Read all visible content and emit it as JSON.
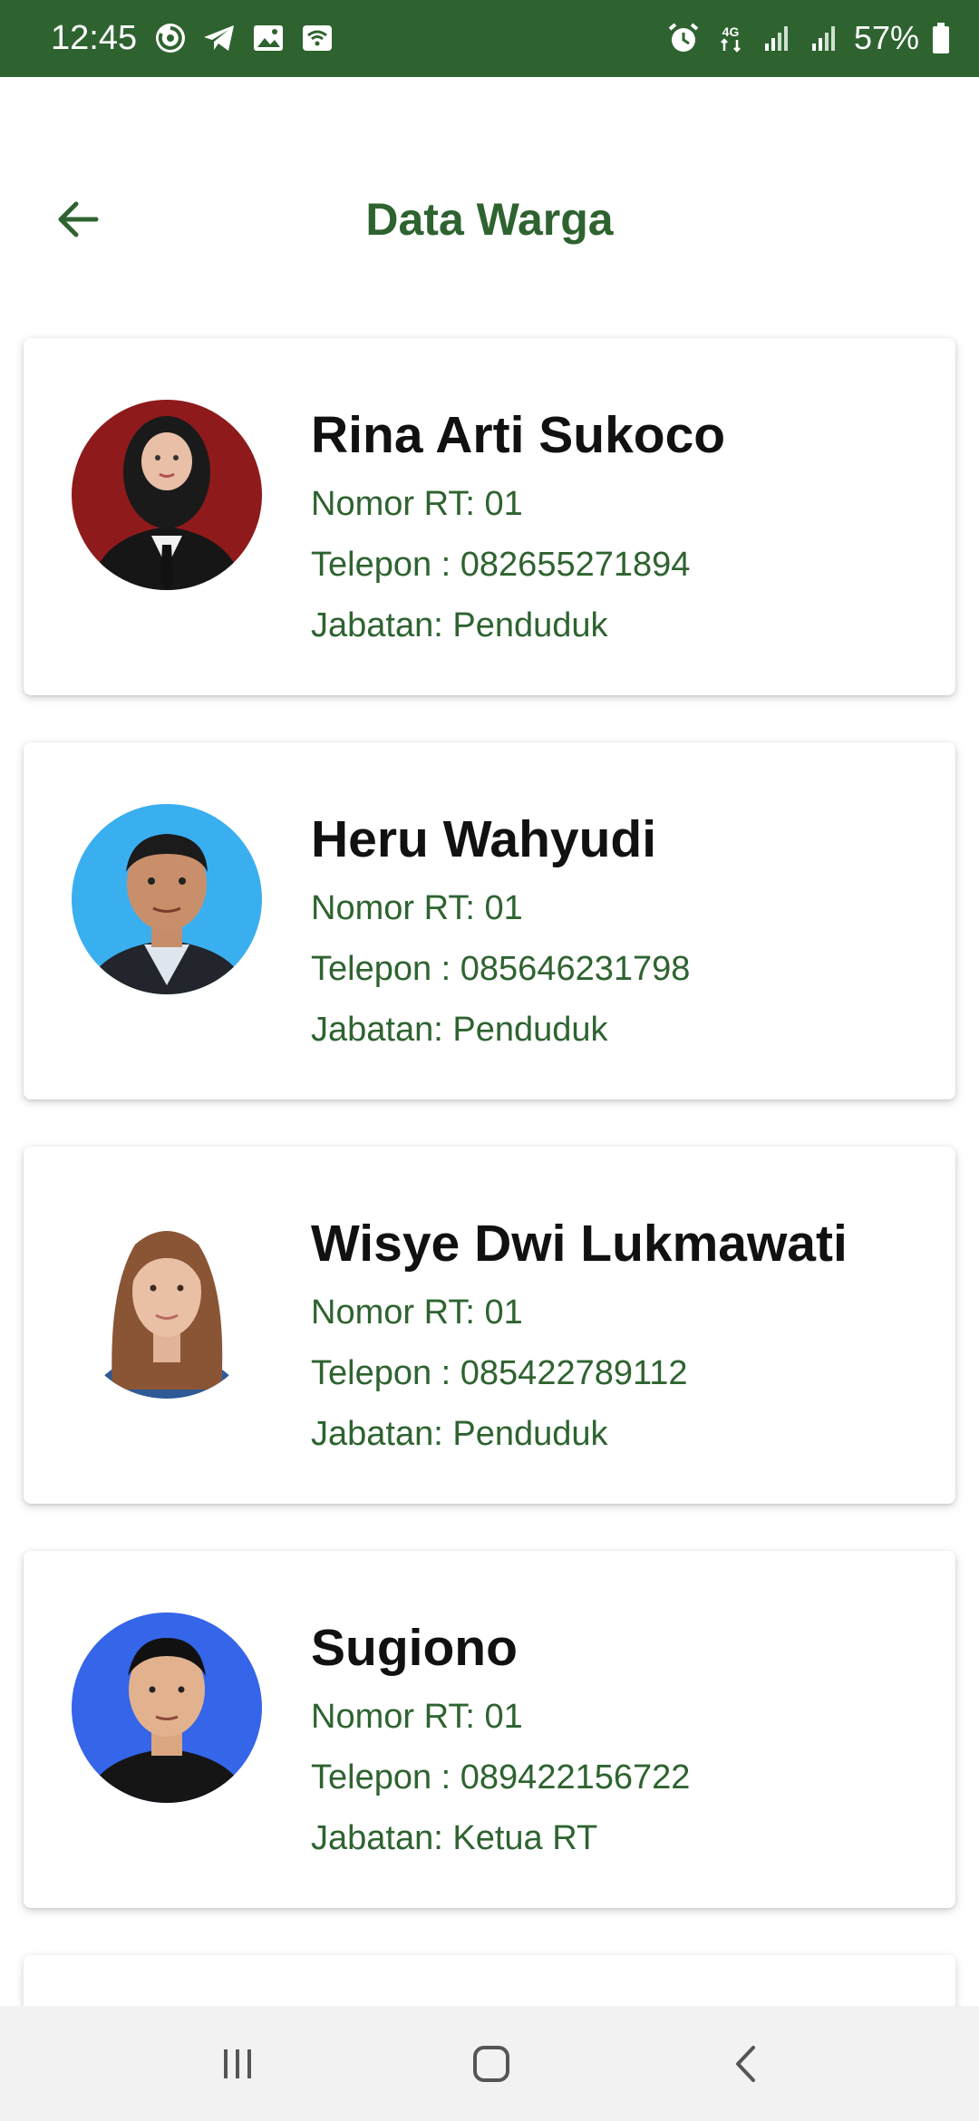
{
  "status_bar": {
    "time": "12:45",
    "battery": "57%",
    "left_icons": [
      "sync-icon",
      "telegram-icon",
      "gallery-icon",
      "wifi-hotspot-icon"
    ],
    "right_icons": [
      "alarm-icon",
      "4g-icon",
      "signal-icon",
      "signal-icon",
      "battery-icon"
    ]
  },
  "header": {
    "title": "Data Warga",
    "back_icon": "arrow-left-icon"
  },
  "residents": [
    {
      "name": "Rina Arti Sukoco",
      "rt": "Nomor RT: 01",
      "phone": "Telepon : 082655271894",
      "position": "Jabatan: Penduduk"
    },
    {
      "name": "Heru Wahyudi",
      "rt": "Nomor RT: 01",
      "phone": "Telepon : 085646231798",
      "position": "Jabatan: Penduduk"
    },
    {
      "name": "Wisye Dwi Lukmawati",
      "rt": "Nomor RT: 01",
      "phone": "Telepon : 085422789112",
      "position": "Jabatan: Penduduk"
    },
    {
      "name": "Sugiono",
      "rt": "Nomor RT: 01",
      "phone": "Telepon : 089422156722",
      "position": "Jabatan: Ketua RT"
    }
  ],
  "nav_bar": {
    "buttons": [
      "recent-apps-icon",
      "home-icon",
      "back-icon"
    ]
  },
  "colors": {
    "primary": "#2e6330",
    "name_text": "#111111",
    "card_bg": "#ffffff",
    "nav_bg": "#f2f2f2"
  }
}
